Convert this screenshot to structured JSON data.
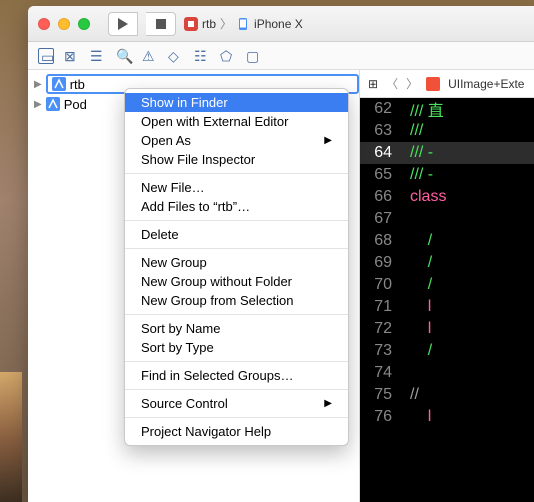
{
  "titlebar": {
    "crumb_icon1": "app-icon",
    "crumb1": "rtb",
    "crumb_icon2": "device-icon",
    "crumb2": "iPhone X"
  },
  "sidebar": {
    "items": [
      {
        "label": "rtb",
        "selected": true
      },
      {
        "label": "Pod",
        "selected": false
      }
    ]
  },
  "editor": {
    "file": "UIImage+Exte",
    "lines": [
      {
        "num": "62",
        "text": "/// 直",
        "color": "c-green"
      },
      {
        "num": "63",
        "text": "///",
        "color": "c-green"
      },
      {
        "num": "64",
        "text": "/// -",
        "color": "c-green",
        "sel": true
      },
      {
        "num": "65",
        "text": "/// -",
        "color": "c-green"
      },
      {
        "num": "66",
        "text": "class",
        "color": "c-red"
      },
      {
        "num": "67",
        "text": "",
        "color": ""
      },
      {
        "num": "68",
        "text": "    /",
        "color": "c-green"
      },
      {
        "num": "69",
        "text": "    /",
        "color": "c-green"
      },
      {
        "num": "70",
        "text": "    /",
        "color": "c-green"
      },
      {
        "num": "71",
        "text": "    l",
        "color": "c-red"
      },
      {
        "num": "72",
        "text": "    l",
        "color": "c-red"
      },
      {
        "num": "73",
        "text": "    /",
        "color": "c-green"
      },
      {
        "num": "74",
        "text": "",
        "color": ""
      },
      {
        "num": "75",
        "text": "//",
        "color": "c-gray"
      },
      {
        "num": "76",
        "text": "    l",
        "color": "c-red"
      }
    ]
  },
  "contextmenu": {
    "items": [
      {
        "label": "Show in Finder",
        "hl": true
      },
      {
        "label": "Open with External Editor"
      },
      {
        "label": "Open As",
        "sub": true
      },
      {
        "label": "Show File Inspector"
      },
      {
        "sep": true
      },
      {
        "label": "New File…"
      },
      {
        "label": "Add Files to “rtb”…"
      },
      {
        "sep": true
      },
      {
        "label": "Delete"
      },
      {
        "sep": true
      },
      {
        "label": "New Group"
      },
      {
        "label": "New Group without Folder"
      },
      {
        "label": "New Group from Selection"
      },
      {
        "sep": true
      },
      {
        "label": "Sort by Name"
      },
      {
        "label": "Sort by Type"
      },
      {
        "sep": true
      },
      {
        "label": "Find in Selected Groups…"
      },
      {
        "sep": true
      },
      {
        "label": "Source Control",
        "sub": true
      },
      {
        "sep": true
      },
      {
        "label": "Project Navigator Help"
      }
    ]
  }
}
